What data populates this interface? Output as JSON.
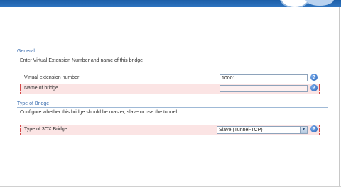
{
  "header": {
    "title": ""
  },
  "general": {
    "heading": "General",
    "description": "Enter Virtual Extension Number and name of this bridge",
    "fields": [
      {
        "label": "Virtual extension number",
        "value": "10001",
        "help": "?"
      },
      {
        "label": "Name of bridge",
        "value": "",
        "help": "?"
      }
    ]
  },
  "type_of_bridge": {
    "heading": "Type of Bridge",
    "description": "Configure whether this bridge should be master, slave or use the tunnel.",
    "field": {
      "label": "Type of 3CX Bridge",
      "selected": "Slave (Tunnel-TCP)",
      "help": "?"
    }
  },
  "colors": {
    "header_blue": "#2e74c0",
    "section_text": "#3d6fb0",
    "highlight_fill": "#fbe4e4",
    "highlight_border": "#d24848"
  },
  "icons": {
    "help": "help-icon",
    "dropdown": "chevron-down-icon"
  }
}
